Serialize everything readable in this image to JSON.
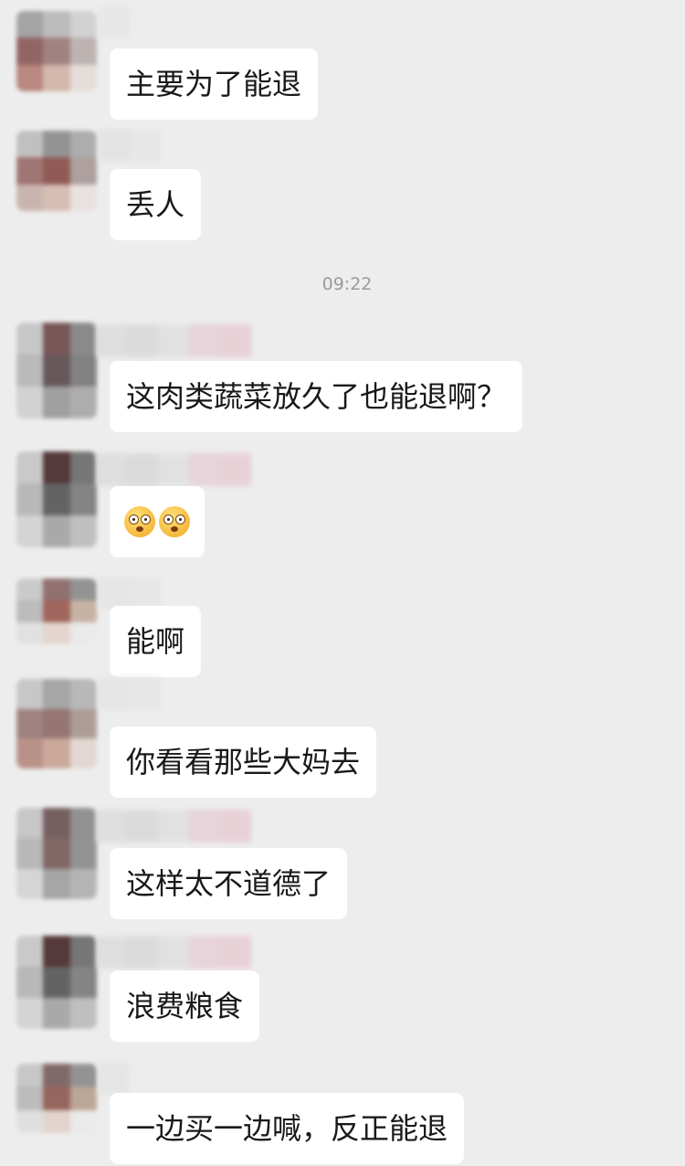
{
  "chat": {
    "timestamp": "09:22",
    "messages": [
      {
        "text": "主要为了能退"
      },
      {
        "text": "丢人"
      },
      {
        "text": "这肉类蔬菜放久了也能退啊？"
      },
      {
        "text": "",
        "emoji": [
          "astonished-face",
          "astonished-face"
        ]
      },
      {
        "text": "能啊"
      },
      {
        "text": "你看看那些大妈去"
      },
      {
        "text": "这样太不道德了"
      },
      {
        "text": "浪费粮食"
      },
      {
        "text": "一边买一边喊，反正能退"
      }
    ]
  }
}
